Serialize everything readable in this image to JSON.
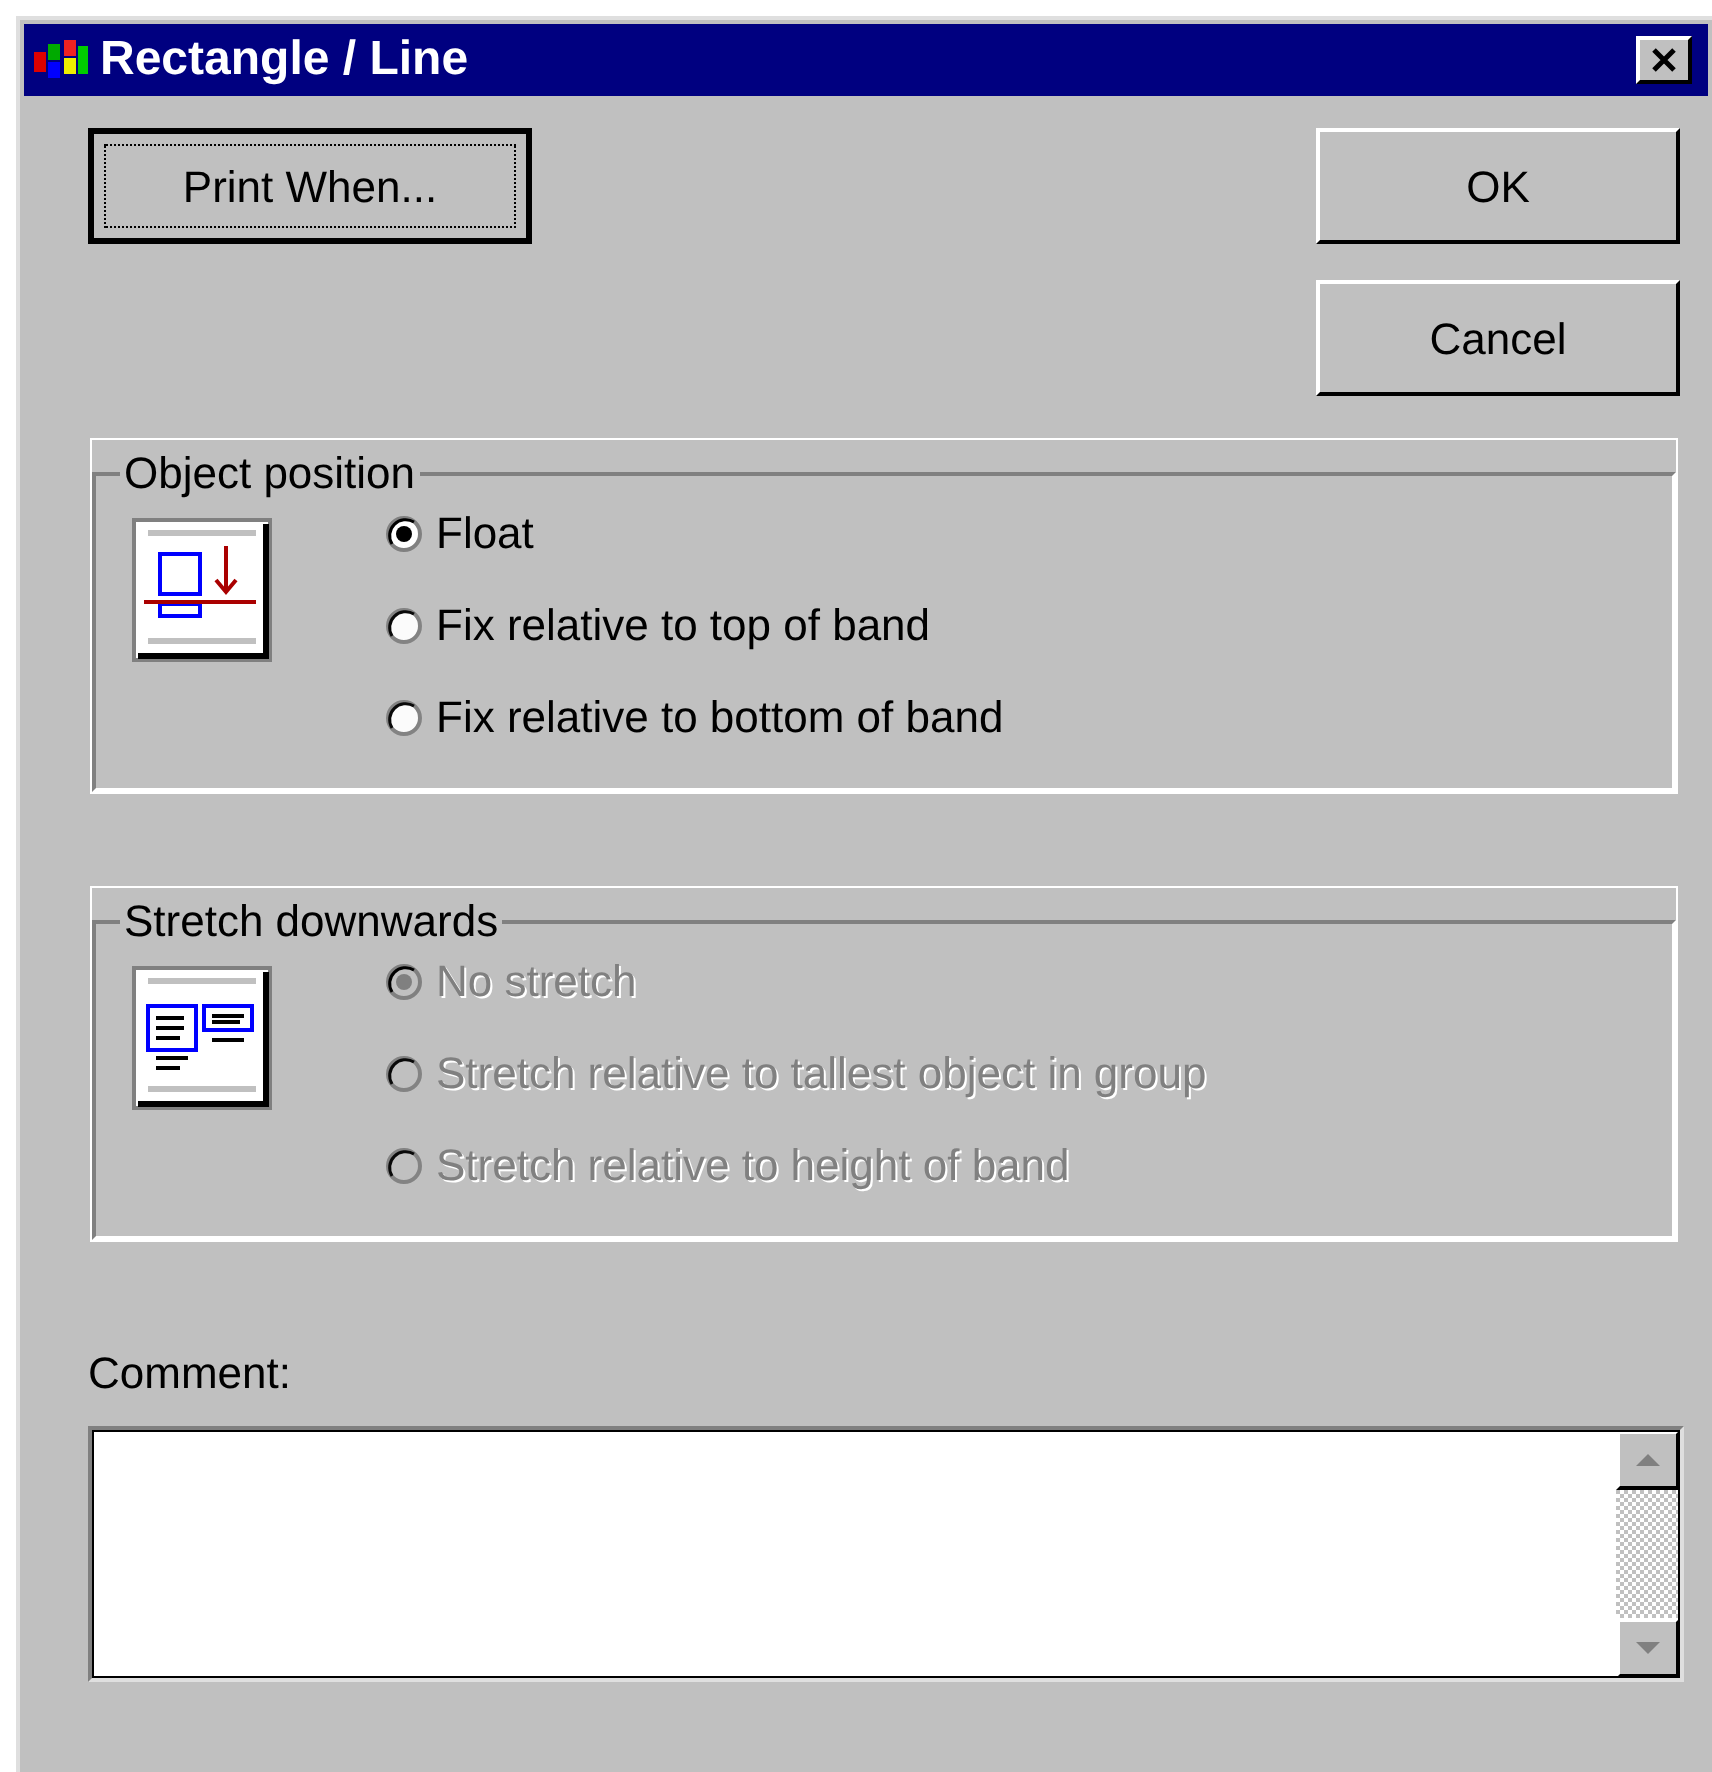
{
  "window": {
    "title": "Rectangle / Line"
  },
  "buttons": [
    {
      "label": "Print When...",
      "kind": "focused"
    },
    {
      "label": "OK",
      "kind": "normal"
    },
    {
      "label": "Cancel",
      "kind": "normal"
    }
  ],
  "groups": [
    {
      "title": "Object position",
      "kind": "position",
      "disabled": false,
      "options": [
        {
          "label": "Float",
          "selected": true
        },
        {
          "label": "Fix relative to top of band",
          "selected": false
        },
        {
          "label": "Fix relative to bottom of band",
          "selected": false
        }
      ]
    },
    {
      "title": "Stretch downwards",
      "kind": "stretch",
      "disabled": true,
      "options": [
        {
          "label": "No stretch",
          "selected": true
        },
        {
          "label": "Stretch relative to tallest object in group",
          "selected": false
        },
        {
          "label": "Stretch relative to height of band",
          "selected": false
        }
      ]
    }
  ],
  "comment": {
    "label": "Comment:"
  }
}
